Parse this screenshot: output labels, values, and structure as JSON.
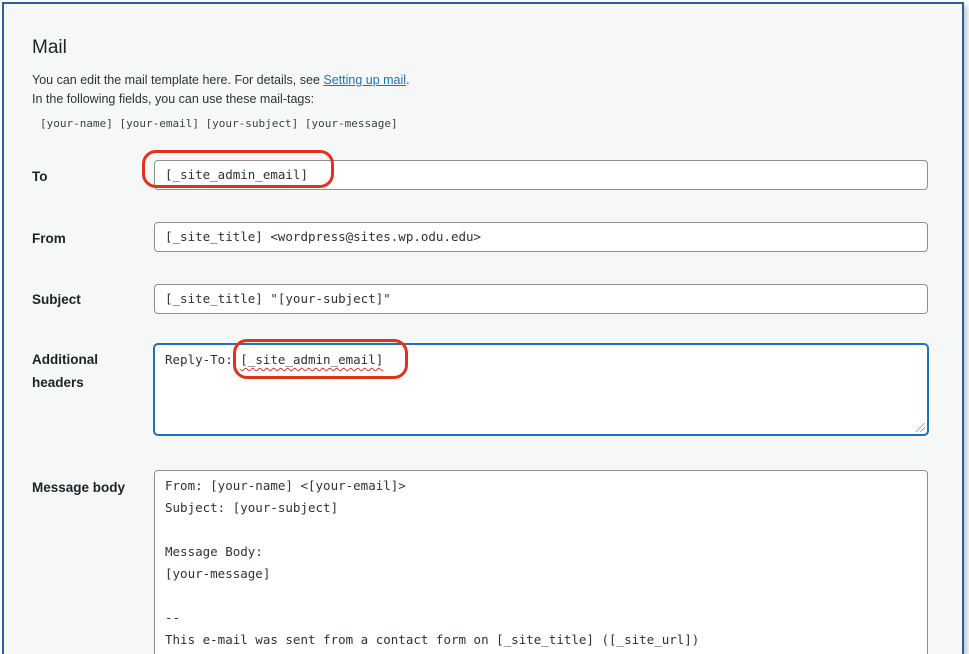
{
  "section": {
    "title": "Mail",
    "description_prefix": "You can edit the mail template here. For details, see ",
    "description_link": "Setting up mail",
    "description_suffix": ".",
    "mail_tags_intro": "In the following fields, you can use these mail-tags:",
    "mail_tags": "[your-name] [your-email] [your-subject] [your-message]"
  },
  "fields": {
    "to": {
      "label": "To",
      "value": "[_site_admin_email]"
    },
    "from": {
      "label": "From",
      "value": "[_site_title] <wordpress@sites.wp.odu.edu>"
    },
    "subject": {
      "label": "Subject",
      "value": "[_site_title] \"[your-subject]\""
    },
    "additional_headers": {
      "label_line1": "Additional",
      "label_line2": "headers",
      "value_prefix": "Reply-To: ",
      "value_tag": "[_site_admin_email]"
    },
    "message_body": {
      "label": "Message body",
      "value": "From: [your-name] <[your-email]>\nSubject: [your-subject]\n\nMessage Body:\n[your-message]\n\n--\nThis e-mail was sent from a contact form on [_site_title] ([_site_url])"
    }
  },
  "annotations": {
    "highlight_color": "#e0321b"
  }
}
